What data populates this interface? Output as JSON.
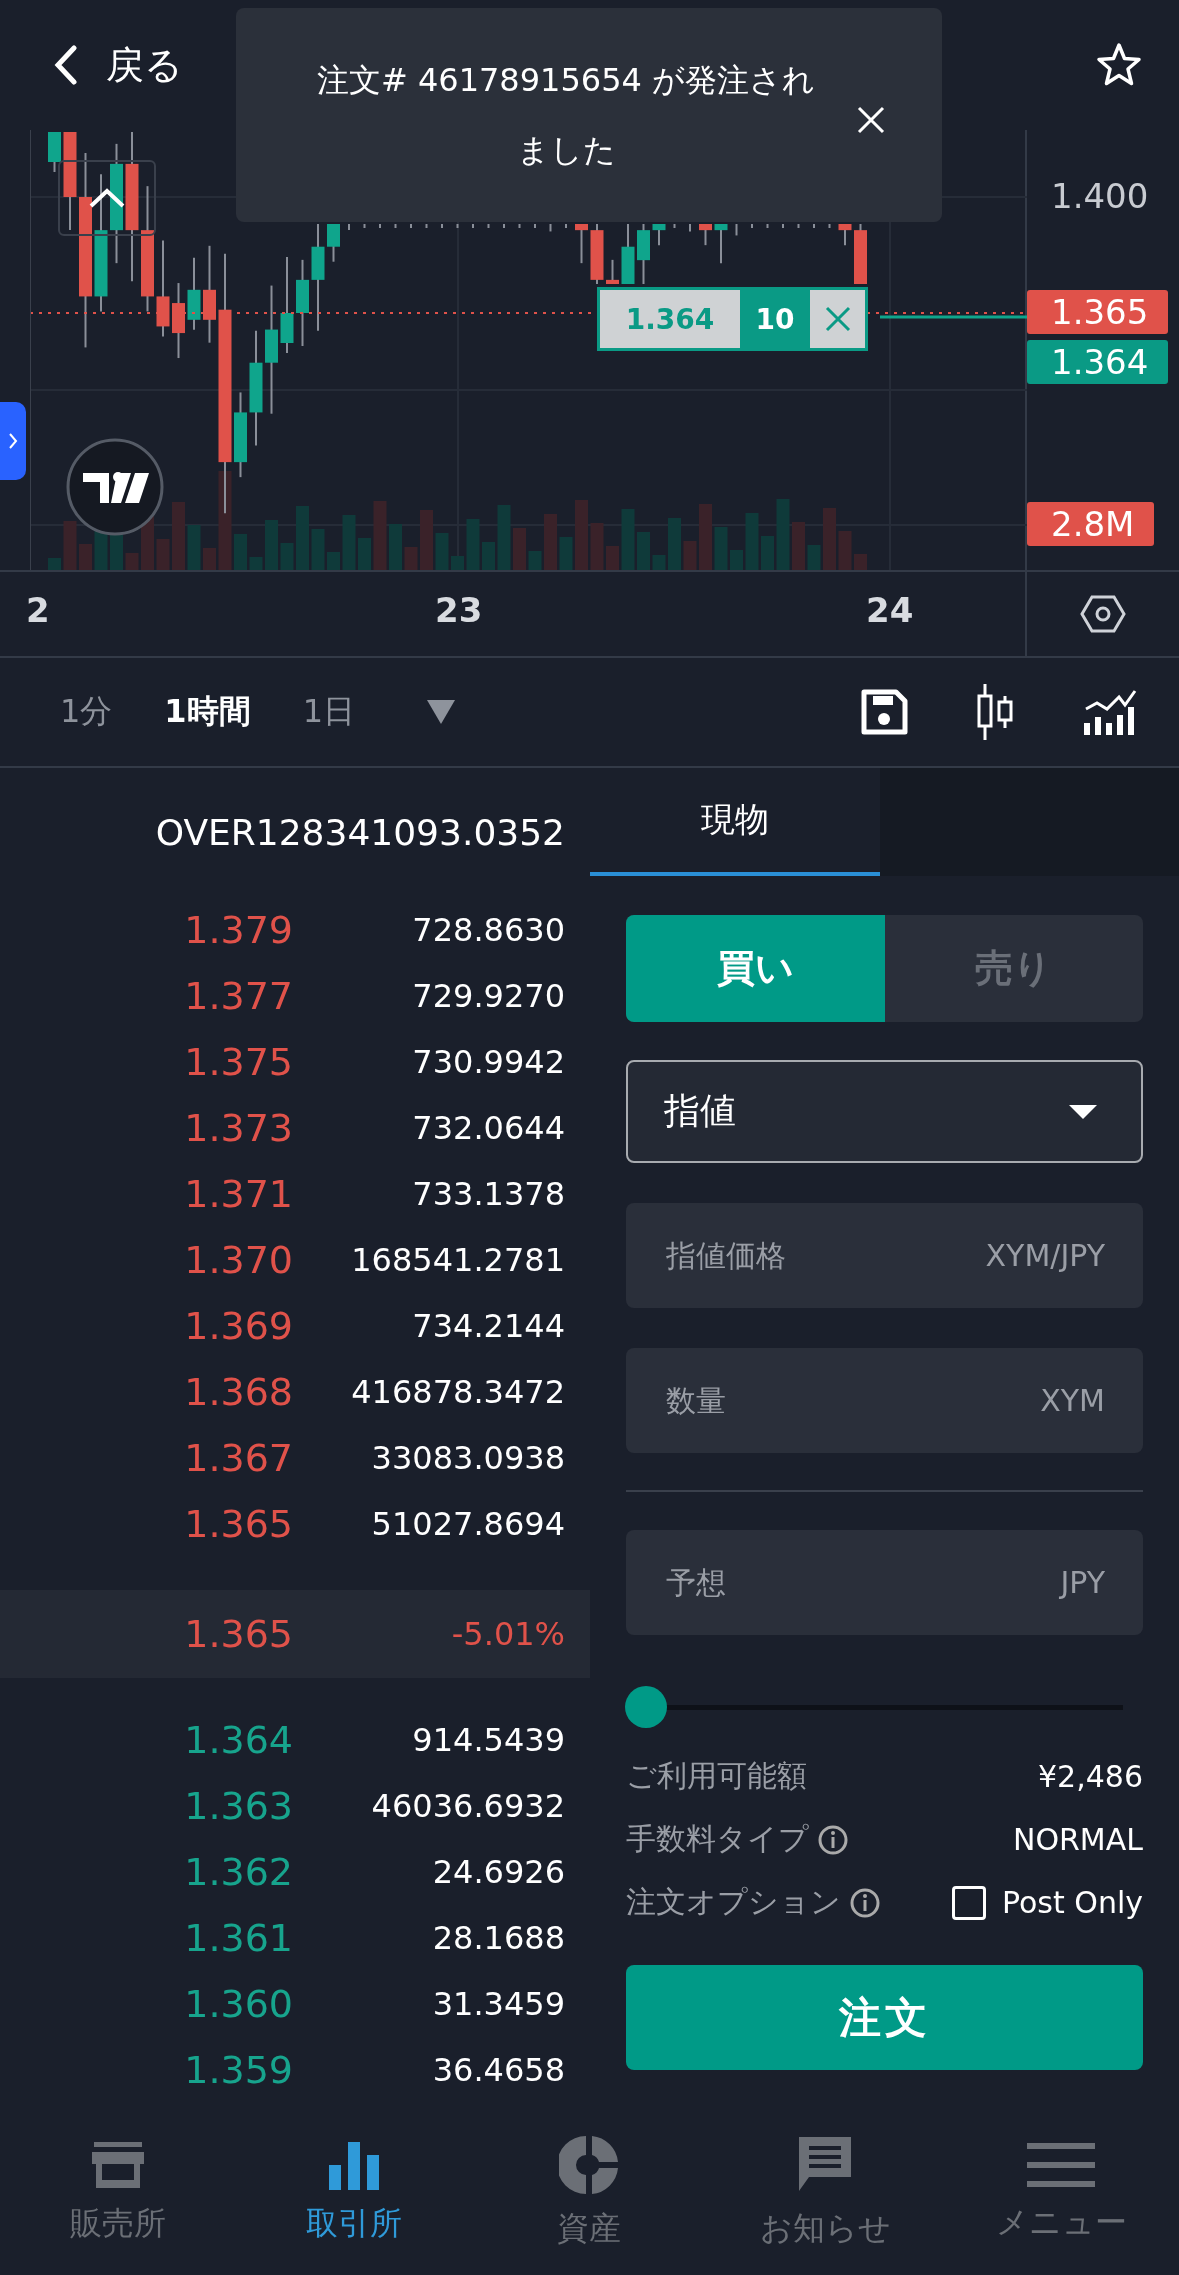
{
  "header": {
    "back_label": "戻る"
  },
  "toast": {
    "message": "注文# 46178915654 が発注されました"
  },
  "chart": {
    "price_label": "1.400",
    "last_price": "1.365",
    "bid_price": "1.364",
    "volume_label": "2.8M",
    "x_labels": [
      "2",
      "23",
      "24"
    ],
    "order_line": {
      "price": "1.364",
      "quantity": "10"
    }
  },
  "toolbar": {
    "intervals": [
      {
        "label": "1分",
        "selected": false
      },
      {
        "label": "1時間",
        "selected": true
      },
      {
        "label": "1日",
        "selected": false
      }
    ]
  },
  "order_book": {
    "header": "OVER128341093.0352",
    "asks": [
      {
        "price": "1.379",
        "amount": "728.8630"
      },
      {
        "price": "1.377",
        "amount": "729.9270"
      },
      {
        "price": "1.375",
        "amount": "730.9942"
      },
      {
        "price": "1.373",
        "amount": "732.0644"
      },
      {
        "price": "1.371",
        "amount": "733.1378"
      },
      {
        "price": "1.370",
        "amount": "168541.2781"
      },
      {
        "price": "1.369",
        "amount": "734.2144"
      },
      {
        "price": "1.368",
        "amount": "416878.3472"
      },
      {
        "price": "1.367",
        "amount": "33083.0938"
      },
      {
        "price": "1.365",
        "amount": "51027.8694"
      }
    ],
    "mid": {
      "price": "1.365",
      "change": "-5.01%"
    },
    "bids": [
      {
        "price": "1.364",
        "amount": "914.5439"
      },
      {
        "price": "1.363",
        "amount": "46036.6932"
      },
      {
        "price": "1.362",
        "amount": "24.6926"
      },
      {
        "price": "1.361",
        "amount": "28.1688"
      },
      {
        "price": "1.360",
        "amount": "31.3459"
      },
      {
        "price": "1.359",
        "amount": "36.4658"
      }
    ]
  },
  "order_form": {
    "tabs": [
      {
        "label": "現物",
        "selected": true
      }
    ],
    "sides": [
      {
        "label": "買い",
        "selected": true
      },
      {
        "label": "売り",
        "selected": false
      }
    ],
    "order_type": "指値",
    "fields": [
      {
        "placeholder": "指値価格",
        "unit": "XYM/JPY"
      },
      {
        "placeholder": "数量",
        "unit": "XYM"
      },
      {
        "placeholder": "予想",
        "unit": "JPY"
      }
    ],
    "slider": {
      "level": 0
    },
    "info": [
      {
        "label": "ご利用可能額",
        "value": "¥2,486",
        "info_icon": false
      },
      {
        "label": "手数料タイプ",
        "value": "NORMAL",
        "info_icon": true
      }
    ],
    "option": {
      "label": "注文オプション",
      "checkbox_label": "Post Only",
      "checked": false
    },
    "submit": "注文"
  },
  "nav": [
    {
      "label": "販売所",
      "selected": false,
      "kind": "shop"
    },
    {
      "label": "取引所",
      "selected": true,
      "kind": "bars"
    },
    {
      "label": "資産",
      "selected": false,
      "kind": "pie"
    },
    {
      "label": "お知らせ",
      "selected": false,
      "kind": "message"
    },
    {
      "label": "メニュー",
      "selected": false,
      "kind": "menu"
    }
  ]
}
